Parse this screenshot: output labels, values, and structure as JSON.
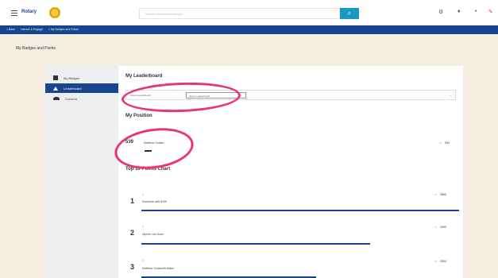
{
  "topbar": {
    "brand": "Rotary",
    "search_placeholder": "Search content and people",
    "search_icon": "search-icon",
    "icons": [
      "settings-icon",
      "user-icon",
      "more-icon",
      "notification-icon"
    ]
  },
  "breadcrumbs": [
    "< Back",
    "Interact & Engage",
    "> My Badges and Points"
  ],
  "page_title": "My Badges and Points",
  "sidebar": {
    "items": [
      {
        "label": "My Badges",
        "icon": "badge-icon"
      },
      {
        "label": "Leaderboard",
        "icon": "leaderboard-icon"
      },
      {
        "label": "Consent",
        "icon": "cloud-icon"
      }
    ],
    "active_index": 1
  },
  "leaderboard": {
    "title": "My Leaderboard",
    "filter_label": "Select Leaderboard",
    "filter_value": "Select Leaderboard"
  },
  "position": {
    "title": "My Position",
    "rank": "539",
    "name": "Matthew Golden",
    "points": "539"
  },
  "top": {
    "title": "Top 10 Points Chart",
    "entries": [
      {
        "rank": "1",
        "name": "Someone with $10K",
        "points": "3865",
        "bar": 1.0
      },
      {
        "rank": "2",
        "name": "Ulphen van Dolm",
        "points": "3490",
        "bar": 0.72
      },
      {
        "rank": "3",
        "name": "Matthew Goldsmith-Baker",
        "points": "3304",
        "bar": 0.55
      }
    ]
  },
  "colors": {
    "brand_blue": "#17458f",
    "accent_teal": "#1a99c0",
    "annotation": "#e8357a",
    "star": "#e8b400"
  }
}
